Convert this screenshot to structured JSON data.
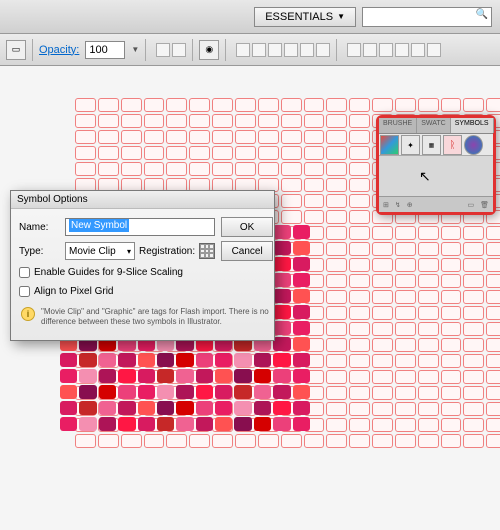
{
  "topbar": {
    "workspace": "ESSENTIALS",
    "search": ""
  },
  "toolbar": {
    "opacity_label": "Opacity:",
    "opacity_value": "100"
  },
  "dialog": {
    "title": "Symbol Options",
    "name_label": "Name:",
    "name_value": "New Symbol",
    "type_label": "Type:",
    "type_value": "Movie Clip",
    "registration_label": "Registration:",
    "ok": "OK",
    "cancel": "Cancel",
    "enable_guides": "Enable Guides for 9-Slice Scaling",
    "align_pixel": "Align to Pixel Grid",
    "info": "\"Movie Clip\" and \"Graphic\" are tags for Flash import. There is no difference between these two symbols in Illustrator."
  },
  "panel": {
    "tabs": [
      "BRUSHE",
      "SWATC",
      "SYMBOLS"
    ],
    "active_tab": 2
  },
  "colors": {
    "grid_palette": [
      "#e91e63",
      "#c2185b",
      "#ad1457",
      "#880e4f",
      "#d81b60",
      "#ec407a",
      "#f06292",
      "#f48fb1",
      "#ff5252",
      "#ff1744",
      "#d50000",
      "#c62828"
    ]
  }
}
